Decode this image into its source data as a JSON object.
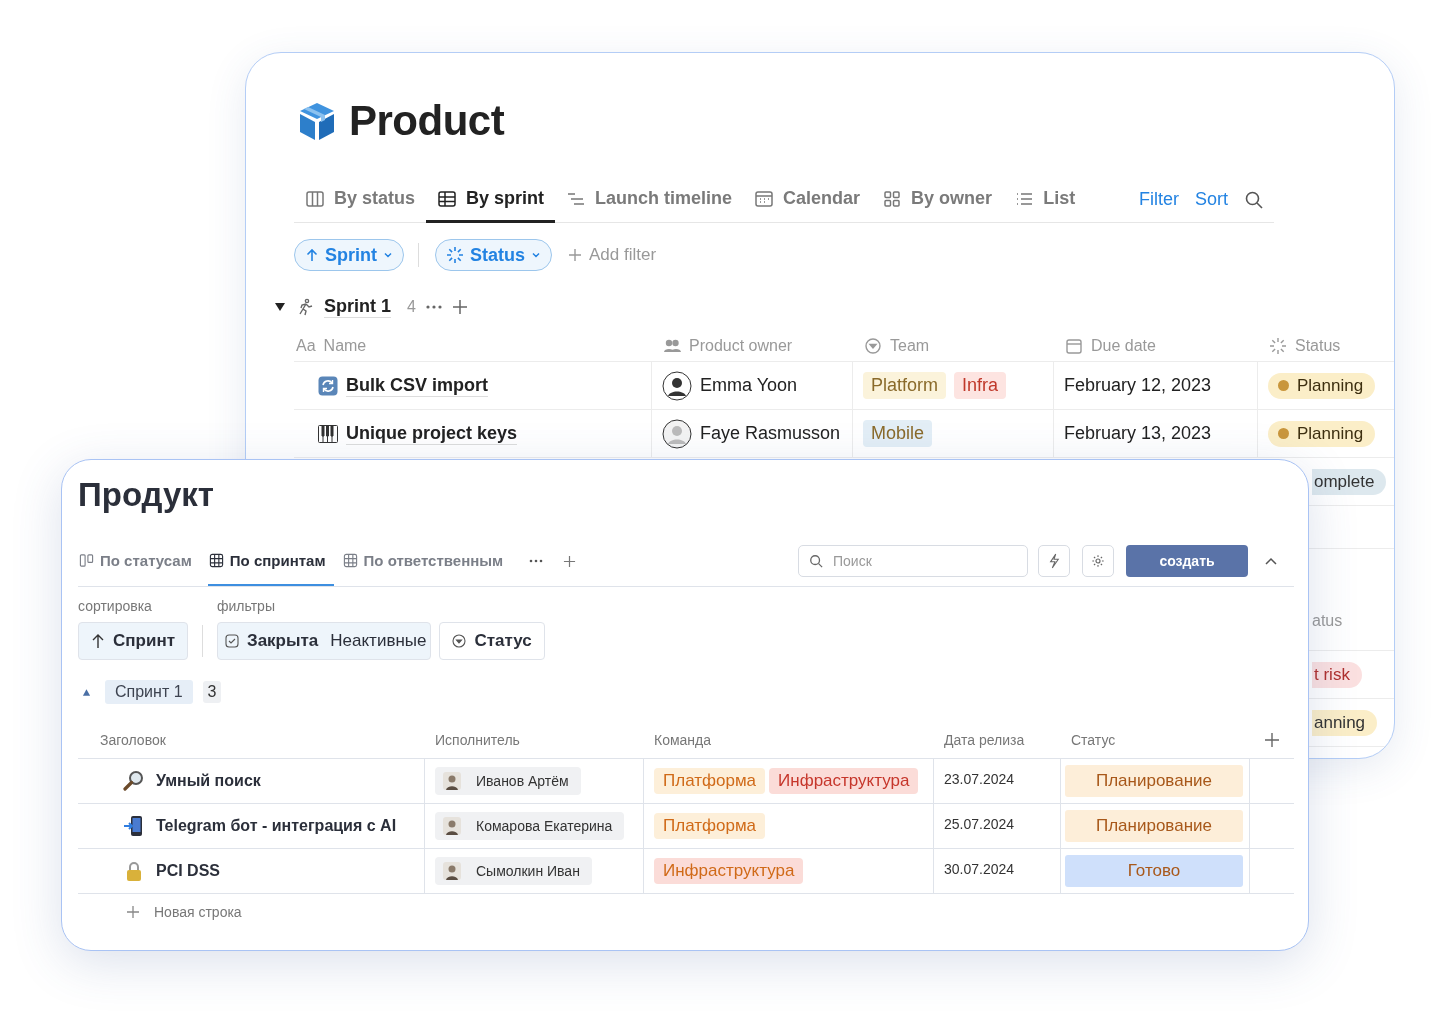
{
  "top_window": {
    "title": "Product",
    "tabs": [
      {
        "label": "By status",
        "selected": false
      },
      {
        "label": "By sprint",
        "selected": true
      },
      {
        "label": "Launch timeline",
        "selected": false
      },
      {
        "label": "Calendar",
        "selected": false
      },
      {
        "label": "By owner",
        "selected": false
      },
      {
        "label": "List",
        "selected": false
      }
    ],
    "actions": [
      "Filter",
      "Sort"
    ],
    "filters": [
      "Sprint",
      "Status"
    ],
    "add_filter": "Add filter",
    "group": {
      "label": "Sprint 1",
      "count": "4",
      "expanded": true
    },
    "columns": [
      {
        "prefix": "Aa",
        "label": "Name"
      },
      {
        "label": "Product owner"
      },
      {
        "label": "Team"
      },
      {
        "label": "Due date"
      },
      {
        "label": "Status"
      }
    ],
    "rows": [
      {
        "name": "Bulk CSV import",
        "owner": "Emma Yoon",
        "team": [
          {
            "label": "Platform",
            "color": "#fbf3db"
          },
          {
            "label": "Infra",
            "color": "#fde4e1"
          }
        ],
        "due": "February 12, 2023",
        "status": {
          "label": "Planning",
          "color": "#fbeec8",
          "dot": {
            "color": "#c9963c"
          }
        }
      },
      {
        "name": "Unique project keys",
        "owner": "Faye Rasmusson",
        "team": [
          {
            "label": "Mobile",
            "color": "#e3eef6"
          }
        ],
        "due": "February 13, 2023",
        "status": {
          "label": "Planning",
          "color": "#fbeec8",
          "dot": {
            "color": "#c9963c"
          }
        }
      }
    ],
    "partial_statuses": [
      {
        "label": "omplete",
        "color": "#dde8ee"
      }
    ],
    "partial_header": "atus",
    "partial_group_statuses": [
      {
        "label": "t risk",
        "color": "#fbe0e0"
      },
      {
        "label": "anning",
        "color": "#fbeec8"
      }
    ]
  },
  "bottom_window": {
    "title": "Продукт",
    "tabs": [
      {
        "label": "По статусам",
        "selected": false
      },
      {
        "label": "По спринтам",
        "selected": true
      },
      {
        "label": "По ответственным",
        "selected": false
      }
    ],
    "search": {
      "placeholder": "Поиск"
    },
    "create_button": "создать",
    "sort_label": "сортировка",
    "filters_label": "фильтры",
    "sort_chip": "Спринт",
    "filter_chip": {
      "label": "Закрыта",
      "value": "Неактивные",
      "checked": true
    },
    "status_chip": "Статус",
    "group": {
      "label": "Спринт 1",
      "count": "3",
      "expanded": true
    },
    "columns": [
      "Заголовок",
      "Исполнитель",
      "Команда",
      "Дата релиза",
      "Статус"
    ],
    "rows": [
      {
        "title": "Умный поиск",
        "assignee": "Иванов Артём",
        "team": [
          {
            "label": "Платформа",
            "color": "#fdefd9"
          },
          {
            "label": "Инфраструктура",
            "color": "#fbdcd8"
          }
        ],
        "date": "23.07.2024",
        "status": {
          "label": "Планирование",
          "color": "#fdeed9"
        }
      },
      {
        "title": "Telegram бот - интеграция с AI",
        "assignee": "Комарова Екатерина",
        "team": [
          {
            "label": "Платформа",
            "color": "#fdefd9"
          }
        ],
        "date": "25.07.2024",
        "status": {
          "label": "Планирование",
          "color": "#fdeed9"
        }
      },
      {
        "title": "PCI DSS",
        "assignee": "Сымолкин Иван",
        "team": [
          {
            "label": "Инфраструктура",
            "color": "#fbdcd8"
          }
        ],
        "date": "30.07.2024",
        "status": {
          "label": "Готово",
          "color": "#cfe0fb"
        }
      }
    ],
    "new_row": "Новая строка"
  }
}
